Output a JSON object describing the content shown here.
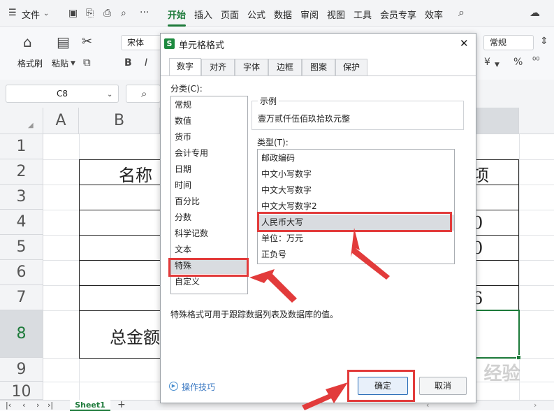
{
  "menu": {
    "hamburger": "☰",
    "file": "文件",
    "tabs": [
      "开始",
      "插入",
      "页面",
      "公式",
      "数据",
      "审阅",
      "视图",
      "工具",
      "会员专享",
      "效率"
    ]
  },
  "ribbon": {
    "format_painter": "格式刷",
    "paste": "粘贴",
    "font_name": "宋体",
    "bold": "B",
    "italic": "I",
    "number_format": "常规",
    "currency_symbol": "¥",
    "percent": "%"
  },
  "formula_bar": {
    "cell_ref": "C8"
  },
  "sheet": {
    "columns": [
      "A",
      "B"
    ],
    "rows": [
      "1",
      "2",
      "3",
      "4",
      "5",
      "6",
      "7",
      "8",
      "9",
      "10"
    ],
    "cell_b2": "名称",
    "cell_b8": "总金额",
    "partial_right": [
      "项",
      "0",
      "0",
      "6"
    ],
    "sheet_tab": "Sheet1",
    "add_sheet": "+"
  },
  "dialog": {
    "title_icon": "S",
    "title": "单元格格式",
    "close": "✕",
    "tabs": [
      "数字",
      "对齐",
      "字体",
      "边框",
      "图案",
      "保护"
    ],
    "category_label": "分类(C):",
    "categories": [
      "常规",
      "数值",
      "货币",
      "会计专用",
      "日期",
      "时间",
      "百分比",
      "分数",
      "科学记数",
      "文本",
      "特殊",
      "自定义"
    ],
    "selected_category": "特殊",
    "sample_label": "示例",
    "sample_value": "壹万贰仟伍佰玖拾玖元整",
    "type_label": "类型(T):",
    "types": [
      "邮政编码",
      "中文小写数字",
      "中文大写数字",
      "中文大写数字2",
      "人民币大写",
      "单位：万元",
      "正负号"
    ],
    "selected_type": "人民币大写",
    "description": "特殊格式可用于跟踪数据列表及数据库的值。",
    "tips_link": "操作技巧",
    "ok": "确定",
    "cancel": "取消"
  },
  "watermark": "Baidu 经验",
  "colors": {
    "accent": "#1d7a3a",
    "highlight": "#e23b3b",
    "selection": "#d9dce0"
  }
}
